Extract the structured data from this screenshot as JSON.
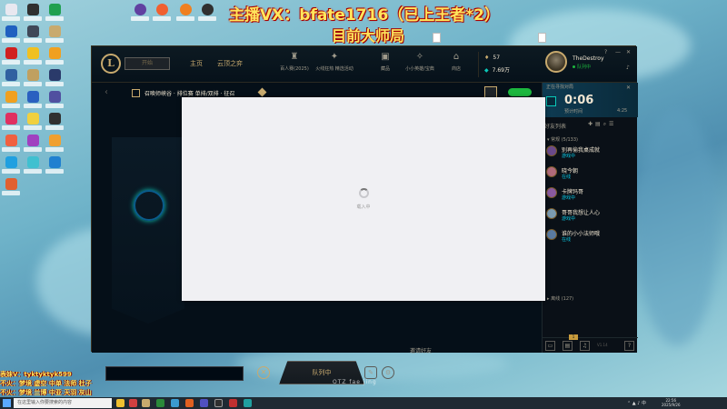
{
  "overlay": {
    "title": "主播VX：bfate1716（已上王者*2）",
    "subtitle": "目前大师局",
    "footer": [
      "表妹V：tyktyktyk599",
      "不火：梦境 虚空 中单 法师 杜子",
      "不火：梦境 兰博 中亚 天羽 灰山"
    ],
    "watermark": "OTZ fae jing"
  },
  "client": {
    "nav": {
      "play": "开始",
      "home": "主页",
      "tft": "云顶之弈"
    },
    "top_icons": [
      "百人赛(2025)",
      "火线狂热 精选活动",
      "藏品",
      "小小英雄/宝典",
      "商店"
    ],
    "currency": {
      "blue_essence": "57",
      "riot_points": "7.69万"
    },
    "profile": {
      "name": "TheDestroy",
      "status": "队列中"
    },
    "window_controls": [
      "?",
      "—",
      "✕"
    ],
    "lobby": {
      "breadcrumb": "召唤师峡谷 · 排位赛 单排/双排 · 征召",
      "invite_note": "邀请好友",
      "find_match": "队列中",
      "cancel": "✕"
    },
    "social": {
      "queue_label": "正在寻找对局",
      "timer": "0:06",
      "estimate_label": "预计时间",
      "estimate_value": "4:25",
      "friends_header": "好友列表",
      "general_group": "▾ 常规 (5/133)",
      "offline_group": "▸ 离线 (127)",
      "friends": [
        {
          "name": "别再偷我桌成就",
          "status": "游戏中"
        },
        {
          "name": "晓今朝",
          "status": "在线"
        },
        {
          "name": "卡牌玛哥",
          "status": "游戏中"
        },
        {
          "name": "哥哥我想让人心",
          "status": "游戏中"
        },
        {
          "name": "谁的小小法师哦",
          "status": "在线"
        }
      ],
      "badge": "1",
      "version": "V1.14"
    },
    "modal": {
      "loading_text": "载入中"
    }
  },
  "taskbar": {
    "search_placeholder": "在这里输入你要搜索的内容",
    "time": "22:56",
    "date": "2025/9/26",
    "lang": "中"
  },
  "colors": {
    "gold": "#c8aa6e",
    "teal": "#0ac8b9",
    "panel": "#010a13",
    "overlay_yellow": "#ffe65c"
  }
}
